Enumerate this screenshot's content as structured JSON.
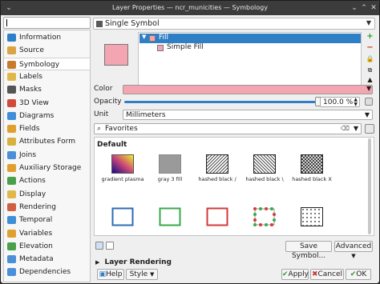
{
  "window": {
    "title": "Layer Properties — ncr_municities — Symbology"
  },
  "sidebar": {
    "search_value": "",
    "items": [
      {
        "label": "Information",
        "icon": "info-icon",
        "color": "#2f7fc6"
      },
      {
        "label": "Source",
        "icon": "source-icon",
        "color": "#d9a441"
      },
      {
        "label": "Symbology",
        "icon": "symbology-icon",
        "color": "#c97b2c"
      },
      {
        "label": "Labels",
        "icon": "labels-icon",
        "color": "#e0b84a"
      },
      {
        "label": "Masks",
        "icon": "masks-icon",
        "color": "#555555"
      },
      {
        "label": "3D View",
        "icon": "3d-view-icon",
        "color": "#d24a3a"
      },
      {
        "label": "Diagrams",
        "icon": "diagrams-icon",
        "color": "#3f8fd8"
      },
      {
        "label": "Fields",
        "icon": "fields-icon",
        "color": "#e0a030"
      },
      {
        "label": "Attributes Form",
        "icon": "attributes-form-icon",
        "color": "#d8b040"
      },
      {
        "label": "Joins",
        "icon": "joins-icon",
        "color": "#4a8fd8"
      },
      {
        "label": "Auxiliary Storage",
        "icon": "auxiliary-storage-icon",
        "color": "#e0a030"
      },
      {
        "label": "Actions",
        "icon": "actions-icon",
        "color": "#4aa04a"
      },
      {
        "label": "Display",
        "icon": "display-icon",
        "color": "#e0b84a"
      },
      {
        "label": "Rendering",
        "icon": "rendering-icon",
        "color": "#d06040"
      },
      {
        "label": "Temporal",
        "icon": "temporal-icon",
        "color": "#3f8fd8"
      },
      {
        "label": "Variables",
        "icon": "variables-icon",
        "color": "#e0a030"
      },
      {
        "label": "Elevation",
        "icon": "elevation-icon",
        "color": "#4aa04a"
      },
      {
        "label": "Metadata",
        "icon": "metadata-icon",
        "color": "#4a8fd8"
      },
      {
        "label": "Dependencies",
        "icon": "dependencies-icon",
        "color": "#4a8fd8"
      }
    ],
    "active_index": 2
  },
  "symbology": {
    "mode": "Single Symbol",
    "tree": [
      {
        "label": "Fill",
        "selected": true
      },
      {
        "label": "Simple Fill",
        "selected": false
      }
    ],
    "fill_color": "#f3a5b1",
    "color_label": "Color",
    "opacity_label": "Opacity",
    "opacity_value": "100.0 %",
    "opacity_fraction": 1.0,
    "unit_label": "Unit",
    "unit_value": "Millimeters",
    "library_filter": "Favorites",
    "library_header": "Default",
    "symbols": [
      {
        "caption": "gradient plasma",
        "kind": "gradient"
      },
      {
        "caption": "gray 3 fill",
        "kind": "gray"
      },
      {
        "caption": "hashed black /",
        "kind": "hash-fwd"
      },
      {
        "caption": "hashed black \\",
        "kind": "hash-back"
      },
      {
        "caption": "hashed black X",
        "kind": "hash-x"
      },
      {
        "caption": "",
        "kind": "outline-blue"
      },
      {
        "caption": "",
        "kind": "outline-green"
      },
      {
        "caption": "",
        "kind": "outline-red"
      },
      {
        "caption": "",
        "kind": "dots-outline"
      },
      {
        "caption": "",
        "kind": "dots"
      }
    ],
    "save_symbol_label": "Save Symbol...",
    "advanced_label": "Advanced",
    "layer_rendering_label": "Layer Rendering"
  },
  "buttons": {
    "help": "Help",
    "style": "Style",
    "apply": "Apply",
    "cancel": "Cancel",
    "ok": "OK"
  }
}
